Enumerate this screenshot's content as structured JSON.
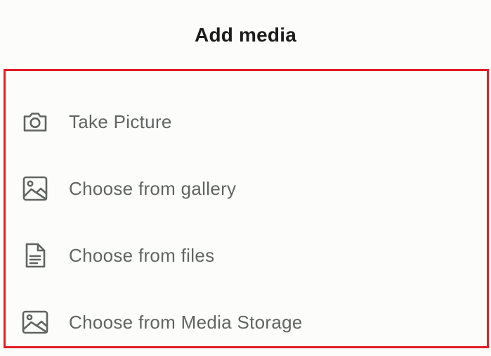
{
  "sheet": {
    "title": "Add media"
  },
  "options": [
    {
      "label": "Take Picture",
      "icon": "camera-icon"
    },
    {
      "label": "Choose from gallery",
      "icon": "image-icon"
    },
    {
      "label": "Choose from files",
      "icon": "file-icon"
    },
    {
      "label": "Choose from Media Storage",
      "icon": "image-icon"
    }
  ],
  "colors": {
    "highlight_border": "#e11f25",
    "label_text": "#606463",
    "icon_stroke": "#5f6462",
    "title_text": "#1b1c1b"
  }
}
